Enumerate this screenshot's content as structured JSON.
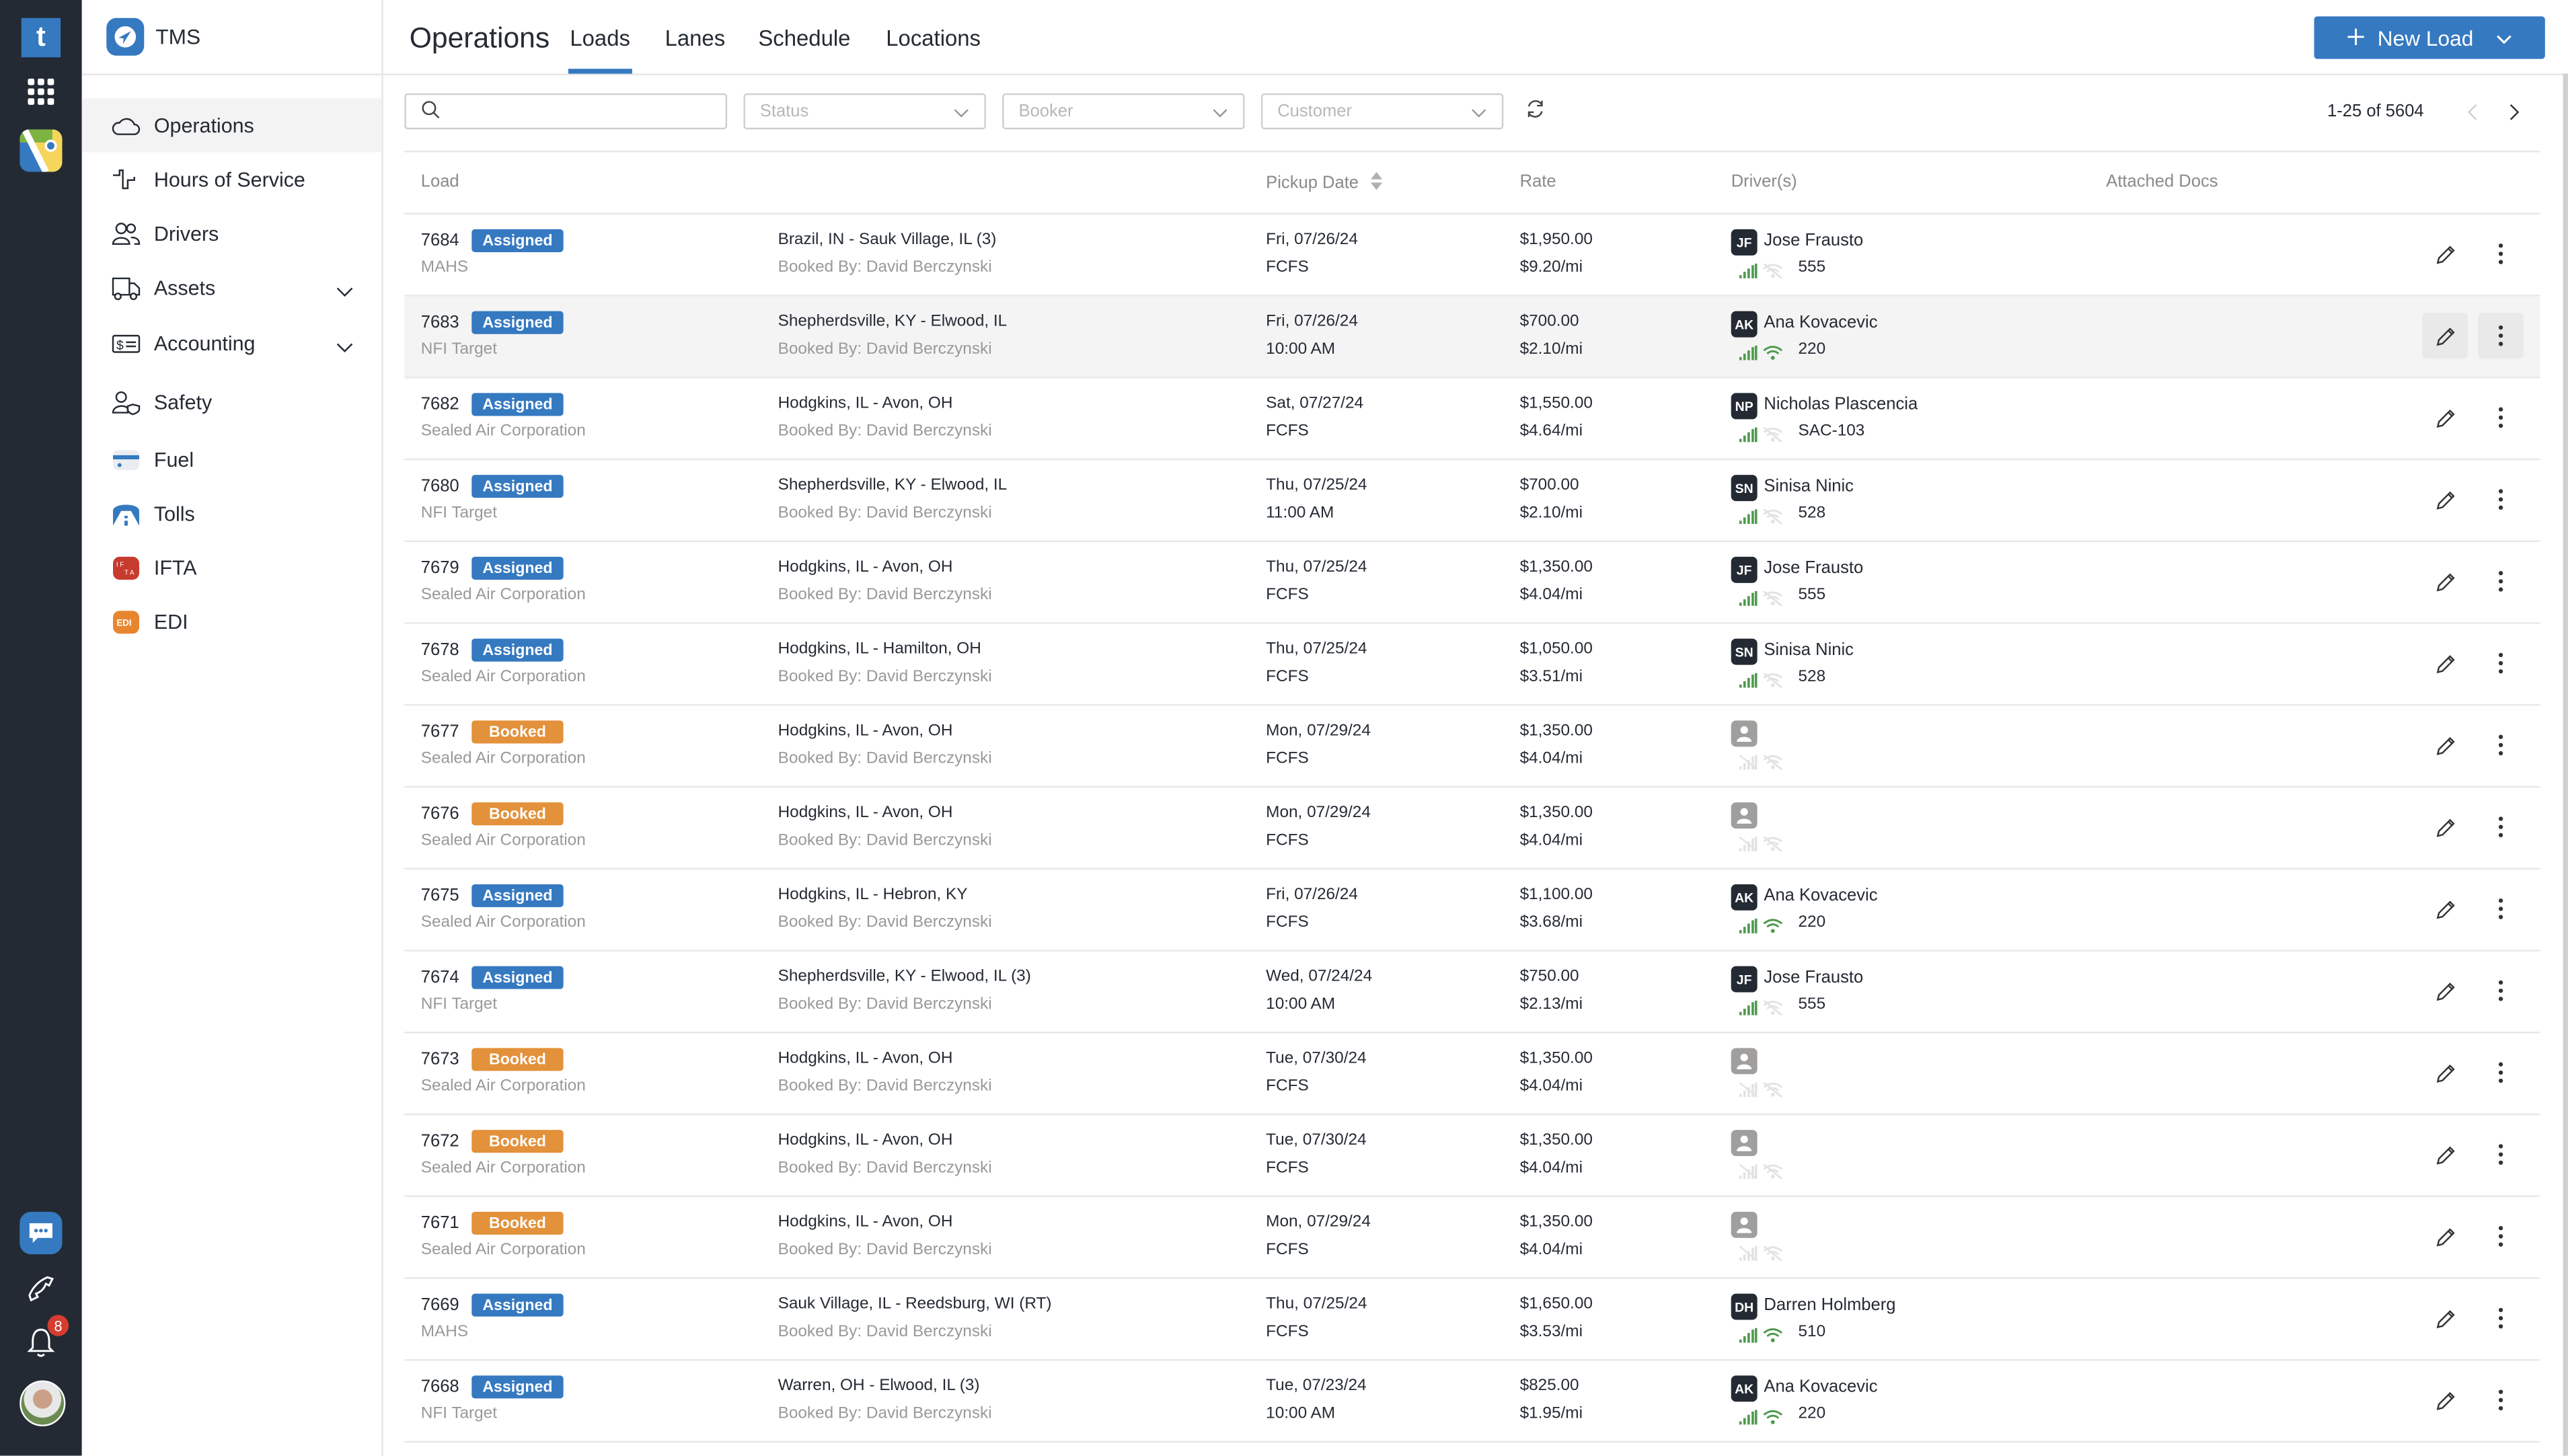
{
  "rail": {
    "notification_count": "8"
  },
  "sidebar": {
    "brand": "TMS",
    "items": [
      {
        "label": "Operations",
        "icon": "cloud-icon",
        "active": true
      },
      {
        "label": "Hours of Service",
        "icon": "hos-pulse-icon"
      },
      {
        "label": "Drivers",
        "icon": "users-icon"
      },
      {
        "label": "Assets",
        "icon": "truck-icon",
        "expandable": true
      },
      {
        "label": "Accounting",
        "icon": "dollar-card-icon",
        "expandable": true
      },
      {
        "label": "Safety",
        "icon": "user-shield-icon"
      },
      {
        "label": "Fuel",
        "icon": "fuel-card-icon"
      },
      {
        "label": "Tolls",
        "icon": "tolls-road-icon"
      },
      {
        "label": "IFTA",
        "icon": "ifta-icon"
      },
      {
        "label": "EDI",
        "icon": "edi-icon"
      }
    ]
  },
  "header": {
    "title": "Operations",
    "tabs": [
      "Loads",
      "Lanes",
      "Schedule",
      "Locations"
    ],
    "active_tab": "Loads",
    "new_load_label": "New Load"
  },
  "filters": {
    "search_placeholder": "",
    "status_placeholder": "Status",
    "booker_placeholder": "Booker",
    "customer_placeholder": "Customer"
  },
  "pagination": {
    "range": "1-25 of 5604"
  },
  "table": {
    "columns": [
      "Load",
      "Pickup Date",
      "Rate",
      "Driver(s)",
      "Attached Docs"
    ],
    "rows": [
      {
        "load": "7684",
        "status": "Assigned",
        "customer": "MAHS",
        "lane": "Brazil, IN - Sauk Village, IL (3)",
        "booked_by": "Booked By: David Berczynski",
        "date": "Fri, 07/26/24",
        "time": "FCFS",
        "rate": "$1,950.00",
        "per_mile": "$9.20/mi",
        "driver_initials": "JF",
        "driver": "Jose Frausto",
        "wifi": false,
        "truck": "555"
      },
      {
        "load": "7683",
        "status": "Assigned",
        "customer": "NFI Target",
        "lane": "Shepherdsville, KY - Elwood, IL",
        "booked_by": "Booked By: David Berczynski",
        "date": "Fri, 07/26/24",
        "time": "10:00 AM",
        "rate": "$700.00",
        "per_mile": "$2.10/mi",
        "driver_initials": "AK",
        "driver": "Ana Kovacevic",
        "wifi": true,
        "truck": "220"
      },
      {
        "load": "7682",
        "status": "Assigned",
        "customer": "Sealed Air Corporation",
        "lane": "Hodgkins, IL - Avon, OH",
        "booked_by": "Booked By: David Berczynski",
        "date": "Sat, 07/27/24",
        "time": "FCFS",
        "rate": "$1,550.00",
        "per_mile": "$4.64/mi",
        "driver_initials": "NP",
        "driver": "Nicholas Plascencia",
        "wifi": false,
        "truck": "SAC-103"
      },
      {
        "load": "7680",
        "status": "Assigned",
        "customer": "NFI Target",
        "lane": "Shepherdsville, KY - Elwood, IL",
        "booked_by": "Booked By: David Berczynski",
        "date": "Thu, 07/25/24",
        "time": "11:00 AM",
        "rate": "$700.00",
        "per_mile": "$2.10/mi",
        "driver_initials": "SN",
        "driver": "Sinisa Ninic",
        "wifi": false,
        "truck": "528"
      },
      {
        "load": "7679",
        "status": "Assigned",
        "customer": "Sealed Air Corporation",
        "lane": "Hodgkins, IL - Avon, OH",
        "booked_by": "Booked By: David Berczynski",
        "date": "Thu, 07/25/24",
        "time": "FCFS",
        "rate": "$1,350.00",
        "per_mile": "$4.04/mi",
        "driver_initials": "JF",
        "driver": "Jose Frausto",
        "wifi": false,
        "truck": "555"
      },
      {
        "load": "7678",
        "status": "Assigned",
        "customer": "Sealed Air Corporation",
        "lane": "Hodgkins, IL - Hamilton, OH",
        "booked_by": "Booked By: David Berczynski",
        "date": "Thu, 07/25/24",
        "time": "FCFS",
        "rate": "$1,050.00",
        "per_mile": "$3.51/mi",
        "driver_initials": "SN",
        "driver": "Sinisa Ninic",
        "wifi": false,
        "truck": "528"
      },
      {
        "load": "7677",
        "status": "Booked",
        "customer": "Sealed Air Corporation",
        "lane": "Hodgkins, IL - Avon, OH",
        "booked_by": "Booked By: David Berczynski",
        "date": "Mon, 07/29/24",
        "time": "FCFS",
        "rate": "$1,350.00",
        "per_mile": "$4.04/mi",
        "driver_initials": "",
        "driver": "",
        "wifi": false,
        "truck": ""
      },
      {
        "load": "7676",
        "status": "Booked",
        "customer": "Sealed Air Corporation",
        "lane": "Hodgkins, IL - Avon, OH",
        "booked_by": "Booked By: David Berczynski",
        "date": "Mon, 07/29/24",
        "time": "FCFS",
        "rate": "$1,350.00",
        "per_mile": "$4.04/mi",
        "driver_initials": "",
        "driver": "",
        "wifi": false,
        "truck": ""
      },
      {
        "load": "7675",
        "status": "Assigned",
        "customer": "Sealed Air Corporation",
        "lane": "Hodgkins, IL - Hebron, KY",
        "booked_by": "Booked By: David Berczynski",
        "date": "Fri, 07/26/24",
        "time": "FCFS",
        "rate": "$1,100.00",
        "per_mile": "$3.68/mi",
        "driver_initials": "AK",
        "driver": "Ana Kovacevic",
        "wifi": true,
        "truck": "220"
      },
      {
        "load": "7674",
        "status": "Assigned",
        "customer": "NFI Target",
        "lane": "Shepherdsville, KY - Elwood, IL (3)",
        "booked_by": "Booked By: David Berczynski",
        "date": "Wed, 07/24/24",
        "time": "10:00 AM",
        "rate": "$750.00",
        "per_mile": "$2.13/mi",
        "driver_initials": "JF",
        "driver": "Jose Frausto",
        "wifi": false,
        "truck": "555"
      },
      {
        "load": "7673",
        "status": "Booked",
        "customer": "Sealed Air Corporation",
        "lane": "Hodgkins, IL - Avon, OH",
        "booked_by": "Booked By: David Berczynski",
        "date": "Tue, 07/30/24",
        "time": "FCFS",
        "rate": "$1,350.00",
        "per_mile": "$4.04/mi",
        "driver_initials": "",
        "driver": "",
        "wifi": false,
        "truck": ""
      },
      {
        "load": "7672",
        "status": "Booked",
        "customer": "Sealed Air Corporation",
        "lane": "Hodgkins, IL - Avon, OH",
        "booked_by": "Booked By: David Berczynski",
        "date": "Tue, 07/30/24",
        "time": "FCFS",
        "rate": "$1,350.00",
        "per_mile": "$4.04/mi",
        "driver_initials": "",
        "driver": "",
        "wifi": false,
        "truck": ""
      },
      {
        "load": "7671",
        "status": "Booked",
        "customer": "Sealed Air Corporation",
        "lane": "Hodgkins, IL - Avon, OH",
        "booked_by": "Booked By: David Berczynski",
        "date": "Mon, 07/29/24",
        "time": "FCFS",
        "rate": "$1,350.00",
        "per_mile": "$4.04/mi",
        "driver_initials": "",
        "driver": "",
        "wifi": false,
        "truck": ""
      },
      {
        "load": "7669",
        "status": "Assigned",
        "customer": "MAHS",
        "lane": "Sauk Village, IL - Reedsburg, WI (RT)",
        "booked_by": "Booked By: David Berczynski",
        "date": "Thu, 07/25/24",
        "time": "FCFS",
        "rate": "$1,650.00",
        "per_mile": "$3.53/mi",
        "driver_initials": "DH",
        "driver": "Darren Holmberg",
        "wifi": true,
        "truck": "510"
      },
      {
        "load": "7668",
        "status": "Assigned",
        "customer": "NFI Target",
        "lane": "Warren, OH - Elwood, IL (3)",
        "booked_by": "Booked By: David Berczynski",
        "date": "Tue, 07/23/24",
        "time": "10:00 AM",
        "rate": "$825.00",
        "per_mile": "$1.95/mi",
        "driver_initials": "AK",
        "driver": "Ana Kovacevic",
        "wifi": true,
        "truck": "220"
      }
    ]
  },
  "colors": {
    "accent": "#3579c0",
    "assigned": "#3579c0",
    "booked": "#e3913a",
    "rail_bg": "#232a33",
    "signal_green": "#4e9a4e"
  }
}
